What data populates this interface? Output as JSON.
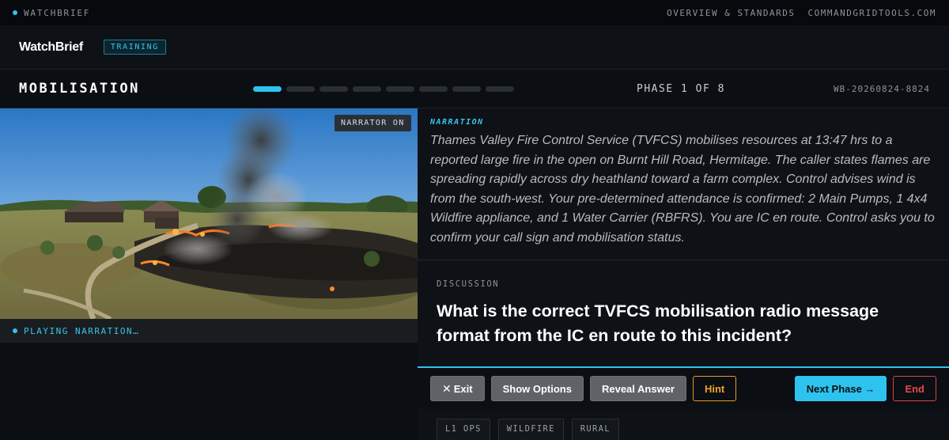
{
  "topbar": {
    "brand": "WATCHBRIEF",
    "links": [
      "OVERVIEW & STANDARDS",
      "COMMANDGRIDTOOLS.COM"
    ]
  },
  "appbar": {
    "logo": "WatchBrief",
    "mode_badge": "TRAINING"
  },
  "phase": {
    "title": "MOBILISATION",
    "current": 1,
    "total": 8,
    "label": "PHASE 1 OF 8",
    "session_id": "WB-20260824-8824"
  },
  "scene": {
    "narrator_badge": "NARRATOR ON",
    "playing_status": "PLAYING NARRATION…"
  },
  "narration": {
    "label": "NARRATION",
    "text": "Thames Valley Fire Control Service (TVFCS) mobilises resources at 13:47 hrs to a reported large fire in the open on Burnt Hill Road, Hermitage. The caller states flames are spreading rapidly across dry heathland toward a farm complex. Control advises wind is from the south-west. Your pre-determined attendance is confirmed: 2 Main Pumps, 1 4x4 Wildfire appliance, and 1 Water Carrier (RBFRS). You are IC en route. Control asks you to confirm your call sign and mobilisation status."
  },
  "discussion": {
    "label": "DISCUSSION",
    "question": "What is the correct TVFCS mobilisation radio message format from the IC en route to this incident?"
  },
  "actions": {
    "exit": "Exit",
    "show_options": "Show Options",
    "reveal_answer": "Reveal Answer",
    "hint": "Hint",
    "next_phase": "Next Phase →",
    "end": "End"
  },
  "tags": [
    "L1 OPS",
    "WILDFIRE",
    "RURAL"
  ],
  "colors": {
    "accent": "#2ec3ee",
    "hint": "#f0a32b",
    "end": "#e5484d"
  }
}
